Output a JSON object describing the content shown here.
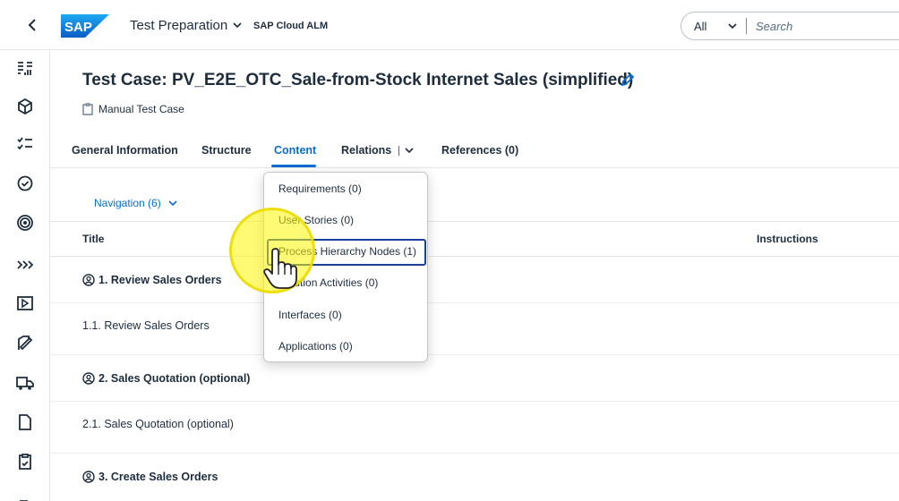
{
  "shell": {
    "back_icon": "chevron-left-icon",
    "logo_text": "SAP",
    "app_title": "Test Preparation",
    "product": "SAP Cloud ALM",
    "search_scope": "All",
    "search_placeholder": "Search"
  },
  "rail": {
    "icons": [
      "requirements-icon",
      "cube-icon",
      "checklist-icon",
      "target-check-icon",
      "target-icon",
      "fast-forward-icon",
      "run-icon",
      "edit-document-icon",
      "truck-icon",
      "document-icon",
      "clipboard-icon",
      "partial-icon"
    ]
  },
  "object": {
    "title": "Test Case: PV_E2E_OTC_Sale-from-Stock Internet Sales (simplified)",
    "subtype": "Manual Test Case"
  },
  "tabs": [
    {
      "label": "General Information"
    },
    {
      "label": "Structure"
    },
    {
      "label": "Content"
    },
    {
      "label": "Relations"
    },
    {
      "label": "References (0)"
    }
  ],
  "navigation": {
    "label": "Navigation (6)"
  },
  "table": {
    "headers": [
      "Title",
      "Instructions"
    ],
    "rows": [
      {
        "label": "1. Review Sales Orders"
      },
      {
        "label": "1.1. Review Sales Orders"
      },
      {
        "label": "2. Sales Quotation (optional)"
      },
      {
        "label": "2.1. Sales Quotation (optional)"
      },
      {
        "label": "3. Create Sales Orders"
      }
    ]
  },
  "relations_menu": {
    "items": [
      "Requirements (0)",
      "User Stories (0)",
      "Process Hierarchy Nodes (1)",
      "Solution Activities (0)",
      "Interfaces (0)",
      "Applications (0)"
    ],
    "focused_index": 2
  },
  "colors": {
    "accent": "#0a6ed1",
    "focus": "#1a3f9e",
    "highlight": "#fff500"
  }
}
